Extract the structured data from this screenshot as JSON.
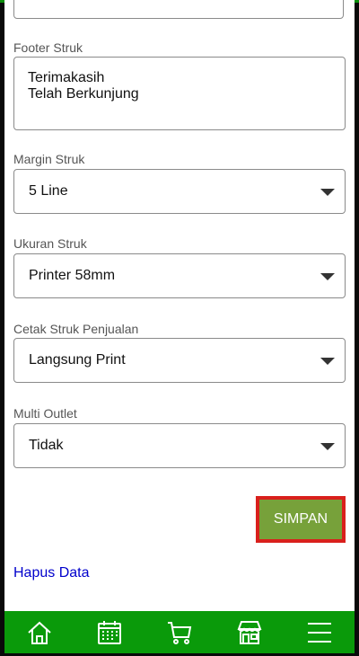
{
  "form": {
    "footer_label": "Footer Struk",
    "footer_value": "Terimakasih\nTelah Berkunjung",
    "margin_label": "Margin Struk",
    "margin_value": "5 Line",
    "ukuran_label": "Ukuran Struk",
    "ukuran_value": "Printer 58mm",
    "cetak_label": "Cetak Struk Penjualan",
    "cetak_value": "Langsung Print",
    "multi_label": "Multi Outlet",
    "multi_value": "Tidak"
  },
  "actions": {
    "save_label": "SIMPAN",
    "delete_link": "Hapus Data"
  },
  "bottom_nav": {
    "items": [
      {
        "icon": "home-icon"
      },
      {
        "icon": "calendar-icon"
      },
      {
        "icon": "cart-icon"
      },
      {
        "icon": "store-icon"
      },
      {
        "icon": "menu-icon"
      }
    ]
  },
  "colors": {
    "nav_bg": "#0a9a0a",
    "save_bg": "#77a13a",
    "save_border": "#d9201c",
    "link": "#0000cc"
  }
}
